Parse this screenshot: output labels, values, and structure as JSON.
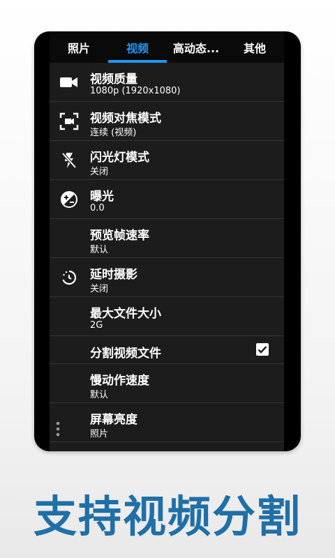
{
  "tabs": [
    {
      "label": "照片",
      "active": false
    },
    {
      "label": "视频",
      "active": true
    },
    {
      "label": "高动态...",
      "active": false
    },
    {
      "label": "其他",
      "active": false
    }
  ],
  "settings": [
    {
      "title": "视频质量",
      "value": "1080p (1920x1080)",
      "icon": "video-camera-icon"
    },
    {
      "title": "视频对焦模式",
      "value": "连续 (视频)",
      "icon": "focus-frame-icon"
    },
    {
      "title": "闪光灯模式",
      "value": "关闭",
      "icon": "flash-off-icon"
    },
    {
      "title": "曝光",
      "value": "0.0",
      "icon": "exposure-icon"
    },
    {
      "title": "预览帧速率",
      "value": "默认",
      "icon": ""
    },
    {
      "title": "延时摄影",
      "value": "关闭",
      "icon": "timelapse-icon"
    },
    {
      "title": "最大文件大小",
      "value": "2G",
      "icon": ""
    },
    {
      "title": "分割视频文件",
      "checked": true
    },
    {
      "title": "慢动作速度",
      "value": "默认",
      "icon": ""
    },
    {
      "title": "屏幕亮度",
      "value": "照片",
      "icon": ""
    }
  ],
  "caption": "支持视频分割",
  "colors": {
    "accent": "#2196f3",
    "caption": "#1f6fa8"
  }
}
